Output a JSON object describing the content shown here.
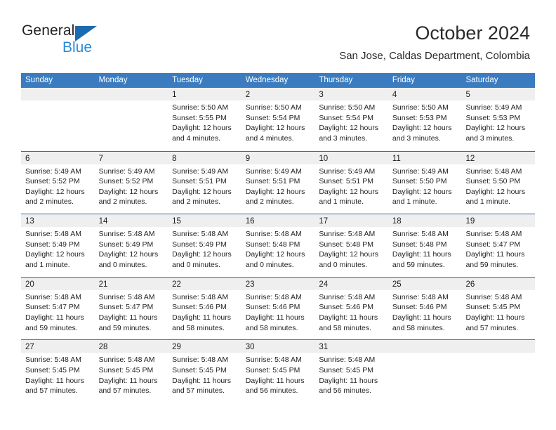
{
  "brand": {
    "line1": "General",
    "line2": "Blue",
    "triangle_color": "#1c6bb0",
    "blue_text_color": "#2b8ad6"
  },
  "header": {
    "month_title": "October 2024",
    "location": "San Jose, Caldas Department, Colombia"
  },
  "theme": {
    "header_row_bg": "#3a7cbf",
    "row_divider": "#2a6ead",
    "day_band_bg": "#efefef"
  },
  "weekdays": [
    "Sunday",
    "Monday",
    "Tuesday",
    "Wednesday",
    "Thursday",
    "Friday",
    "Saturday"
  ],
  "weeks": [
    [
      {
        "day": "",
        "empty": true,
        "sunrise": "",
        "sunset": "",
        "daylight_line1": "",
        "daylight_line2": ""
      },
      {
        "day": "",
        "empty": true,
        "sunrise": "",
        "sunset": "",
        "daylight_line1": "",
        "daylight_line2": ""
      },
      {
        "day": "1",
        "empty": false,
        "sunrise": "Sunrise: 5:50 AM",
        "sunset": "Sunset: 5:55 PM",
        "daylight_line1": "Daylight: 12 hours",
        "daylight_line2": "and 4 minutes."
      },
      {
        "day": "2",
        "empty": false,
        "sunrise": "Sunrise: 5:50 AM",
        "sunset": "Sunset: 5:54 PM",
        "daylight_line1": "Daylight: 12 hours",
        "daylight_line2": "and 4 minutes."
      },
      {
        "day": "3",
        "empty": false,
        "sunrise": "Sunrise: 5:50 AM",
        "sunset": "Sunset: 5:54 PM",
        "daylight_line1": "Daylight: 12 hours",
        "daylight_line2": "and 3 minutes."
      },
      {
        "day": "4",
        "empty": false,
        "sunrise": "Sunrise: 5:50 AM",
        "sunset": "Sunset: 5:53 PM",
        "daylight_line1": "Daylight: 12 hours",
        "daylight_line2": "and 3 minutes."
      },
      {
        "day": "5",
        "empty": false,
        "sunrise": "Sunrise: 5:49 AM",
        "sunset": "Sunset: 5:53 PM",
        "daylight_line1": "Daylight: 12 hours",
        "daylight_line2": "and 3 minutes."
      }
    ],
    [
      {
        "day": "6",
        "empty": false,
        "sunrise": "Sunrise: 5:49 AM",
        "sunset": "Sunset: 5:52 PM",
        "daylight_line1": "Daylight: 12 hours",
        "daylight_line2": "and 2 minutes."
      },
      {
        "day": "7",
        "empty": false,
        "sunrise": "Sunrise: 5:49 AM",
        "sunset": "Sunset: 5:52 PM",
        "daylight_line1": "Daylight: 12 hours",
        "daylight_line2": "and 2 minutes."
      },
      {
        "day": "8",
        "empty": false,
        "sunrise": "Sunrise: 5:49 AM",
        "sunset": "Sunset: 5:51 PM",
        "daylight_line1": "Daylight: 12 hours",
        "daylight_line2": "and 2 minutes."
      },
      {
        "day": "9",
        "empty": false,
        "sunrise": "Sunrise: 5:49 AM",
        "sunset": "Sunset: 5:51 PM",
        "daylight_line1": "Daylight: 12 hours",
        "daylight_line2": "and 2 minutes."
      },
      {
        "day": "10",
        "empty": false,
        "sunrise": "Sunrise: 5:49 AM",
        "sunset": "Sunset: 5:51 PM",
        "daylight_line1": "Daylight: 12 hours",
        "daylight_line2": "and 1 minute."
      },
      {
        "day": "11",
        "empty": false,
        "sunrise": "Sunrise: 5:49 AM",
        "sunset": "Sunset: 5:50 PM",
        "daylight_line1": "Daylight: 12 hours",
        "daylight_line2": "and 1 minute."
      },
      {
        "day": "12",
        "empty": false,
        "sunrise": "Sunrise: 5:48 AM",
        "sunset": "Sunset: 5:50 PM",
        "daylight_line1": "Daylight: 12 hours",
        "daylight_line2": "and 1 minute."
      }
    ],
    [
      {
        "day": "13",
        "empty": false,
        "sunrise": "Sunrise: 5:48 AM",
        "sunset": "Sunset: 5:49 PM",
        "daylight_line1": "Daylight: 12 hours",
        "daylight_line2": "and 1 minute."
      },
      {
        "day": "14",
        "empty": false,
        "sunrise": "Sunrise: 5:48 AM",
        "sunset": "Sunset: 5:49 PM",
        "daylight_line1": "Daylight: 12 hours",
        "daylight_line2": "and 0 minutes."
      },
      {
        "day": "15",
        "empty": false,
        "sunrise": "Sunrise: 5:48 AM",
        "sunset": "Sunset: 5:49 PM",
        "daylight_line1": "Daylight: 12 hours",
        "daylight_line2": "and 0 minutes."
      },
      {
        "day": "16",
        "empty": false,
        "sunrise": "Sunrise: 5:48 AM",
        "sunset": "Sunset: 5:48 PM",
        "daylight_line1": "Daylight: 12 hours",
        "daylight_line2": "and 0 minutes."
      },
      {
        "day": "17",
        "empty": false,
        "sunrise": "Sunrise: 5:48 AM",
        "sunset": "Sunset: 5:48 PM",
        "daylight_line1": "Daylight: 12 hours",
        "daylight_line2": "and 0 minutes."
      },
      {
        "day": "18",
        "empty": false,
        "sunrise": "Sunrise: 5:48 AM",
        "sunset": "Sunset: 5:48 PM",
        "daylight_line1": "Daylight: 11 hours",
        "daylight_line2": "and 59 minutes."
      },
      {
        "day": "19",
        "empty": false,
        "sunrise": "Sunrise: 5:48 AM",
        "sunset": "Sunset: 5:47 PM",
        "daylight_line1": "Daylight: 11 hours",
        "daylight_line2": "and 59 minutes."
      }
    ],
    [
      {
        "day": "20",
        "empty": false,
        "sunrise": "Sunrise: 5:48 AM",
        "sunset": "Sunset: 5:47 PM",
        "daylight_line1": "Daylight: 11 hours",
        "daylight_line2": "and 59 minutes."
      },
      {
        "day": "21",
        "empty": false,
        "sunrise": "Sunrise: 5:48 AM",
        "sunset": "Sunset: 5:47 PM",
        "daylight_line1": "Daylight: 11 hours",
        "daylight_line2": "and 59 minutes."
      },
      {
        "day": "22",
        "empty": false,
        "sunrise": "Sunrise: 5:48 AM",
        "sunset": "Sunset: 5:46 PM",
        "daylight_line1": "Daylight: 11 hours",
        "daylight_line2": "and 58 minutes."
      },
      {
        "day": "23",
        "empty": false,
        "sunrise": "Sunrise: 5:48 AM",
        "sunset": "Sunset: 5:46 PM",
        "daylight_line1": "Daylight: 11 hours",
        "daylight_line2": "and 58 minutes."
      },
      {
        "day": "24",
        "empty": false,
        "sunrise": "Sunrise: 5:48 AM",
        "sunset": "Sunset: 5:46 PM",
        "daylight_line1": "Daylight: 11 hours",
        "daylight_line2": "and 58 minutes."
      },
      {
        "day": "25",
        "empty": false,
        "sunrise": "Sunrise: 5:48 AM",
        "sunset": "Sunset: 5:46 PM",
        "daylight_line1": "Daylight: 11 hours",
        "daylight_line2": "and 58 minutes."
      },
      {
        "day": "26",
        "empty": false,
        "sunrise": "Sunrise: 5:48 AM",
        "sunset": "Sunset: 5:45 PM",
        "daylight_line1": "Daylight: 11 hours",
        "daylight_line2": "and 57 minutes."
      }
    ],
    [
      {
        "day": "27",
        "empty": false,
        "sunrise": "Sunrise: 5:48 AM",
        "sunset": "Sunset: 5:45 PM",
        "daylight_line1": "Daylight: 11 hours",
        "daylight_line2": "and 57 minutes."
      },
      {
        "day": "28",
        "empty": false,
        "sunrise": "Sunrise: 5:48 AM",
        "sunset": "Sunset: 5:45 PM",
        "daylight_line1": "Daylight: 11 hours",
        "daylight_line2": "and 57 minutes."
      },
      {
        "day": "29",
        "empty": false,
        "sunrise": "Sunrise: 5:48 AM",
        "sunset": "Sunset: 5:45 PM",
        "daylight_line1": "Daylight: 11 hours",
        "daylight_line2": "and 57 minutes."
      },
      {
        "day": "30",
        "empty": false,
        "sunrise": "Sunrise: 5:48 AM",
        "sunset": "Sunset: 5:45 PM",
        "daylight_line1": "Daylight: 11 hours",
        "daylight_line2": "and 56 minutes."
      },
      {
        "day": "31",
        "empty": false,
        "sunrise": "Sunrise: 5:48 AM",
        "sunset": "Sunset: 5:45 PM",
        "daylight_line1": "Daylight: 11 hours",
        "daylight_line2": "and 56 minutes."
      },
      {
        "day": "",
        "empty": true,
        "sunrise": "",
        "sunset": "",
        "daylight_line1": "",
        "daylight_line2": ""
      },
      {
        "day": "",
        "empty": true,
        "sunrise": "",
        "sunset": "",
        "daylight_line1": "",
        "daylight_line2": ""
      }
    ]
  ]
}
